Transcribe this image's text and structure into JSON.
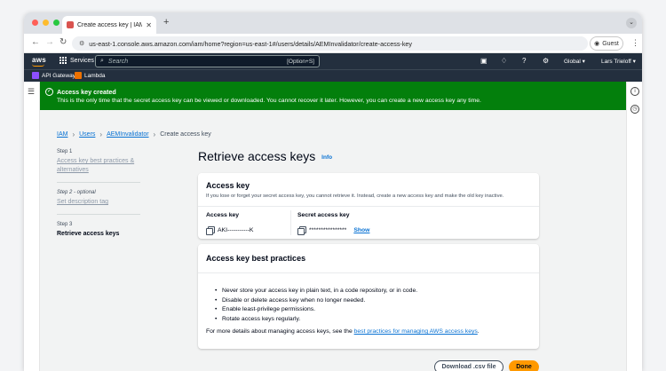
{
  "browser": {
    "tab_title": "Create access key | IAM | Glo",
    "url": "us-east-1.console.aws.amazon.com/iam/home?region=us-east-1#/users/details/AEMInvalidator/create-access-key",
    "profile_label": "Guest",
    "traffic_lights": [
      "#ff5f57",
      "#febc2e",
      "#28c840"
    ]
  },
  "aws_nav": {
    "logo": "aws",
    "services_label": "Services",
    "search_placeholder": "Search",
    "search_shortcut": "[Option+S]",
    "region": "Global ▾",
    "user": "Lars Trieloff ▾"
  },
  "favorites": [
    {
      "label": "API Gateway",
      "color": "#8c4fff"
    },
    {
      "label": "Lambda",
      "color": "#ed7100"
    }
  ],
  "flash": {
    "title": "Access key created",
    "message": "This is the only time that the secret access key can be viewed or downloaded. You cannot recover it later. However, you can create a new access key any time.",
    "color": "#037f0c"
  },
  "breadcrumb": {
    "items": [
      "IAM",
      "Users",
      "AEMInvalidator"
    ],
    "current": "Create access key"
  },
  "steps": [
    {
      "number": "Step 1",
      "title": "Access key best practices & alternatives"
    },
    {
      "number": "Step 2 - optional",
      "title": "Set description tag"
    },
    {
      "number": "Step 3",
      "title": "Retrieve access keys"
    }
  ],
  "page": {
    "title": "Retrieve access keys",
    "info": "Info"
  },
  "access_key_card": {
    "heading": "Access key",
    "description": "If you lose or forget your secret access key, you cannot retrieve it. Instead, create a new access key and make the old key inactive.",
    "col_access_key": "Access key",
    "col_secret_key": "Secret access key",
    "access_key_value": "AKI-----------K",
    "secret_key_value": "****************",
    "show_label": "Show"
  },
  "best_practices_card": {
    "heading": "Access key best practices",
    "items": [
      "Never store your access key in plain text, in a code repository, or in code.",
      "Disable or delete access key when no longer needed.",
      "Enable least-privilege permissions.",
      "Rotate access keys regularly."
    ],
    "more_prefix": "For more details about managing access keys, see the ",
    "more_link": "best practices for managing AWS access keys",
    "more_suffix": "."
  },
  "actions": {
    "download_csv": "Download .csv file",
    "done": "Done",
    "done_color": "#ff9900"
  }
}
